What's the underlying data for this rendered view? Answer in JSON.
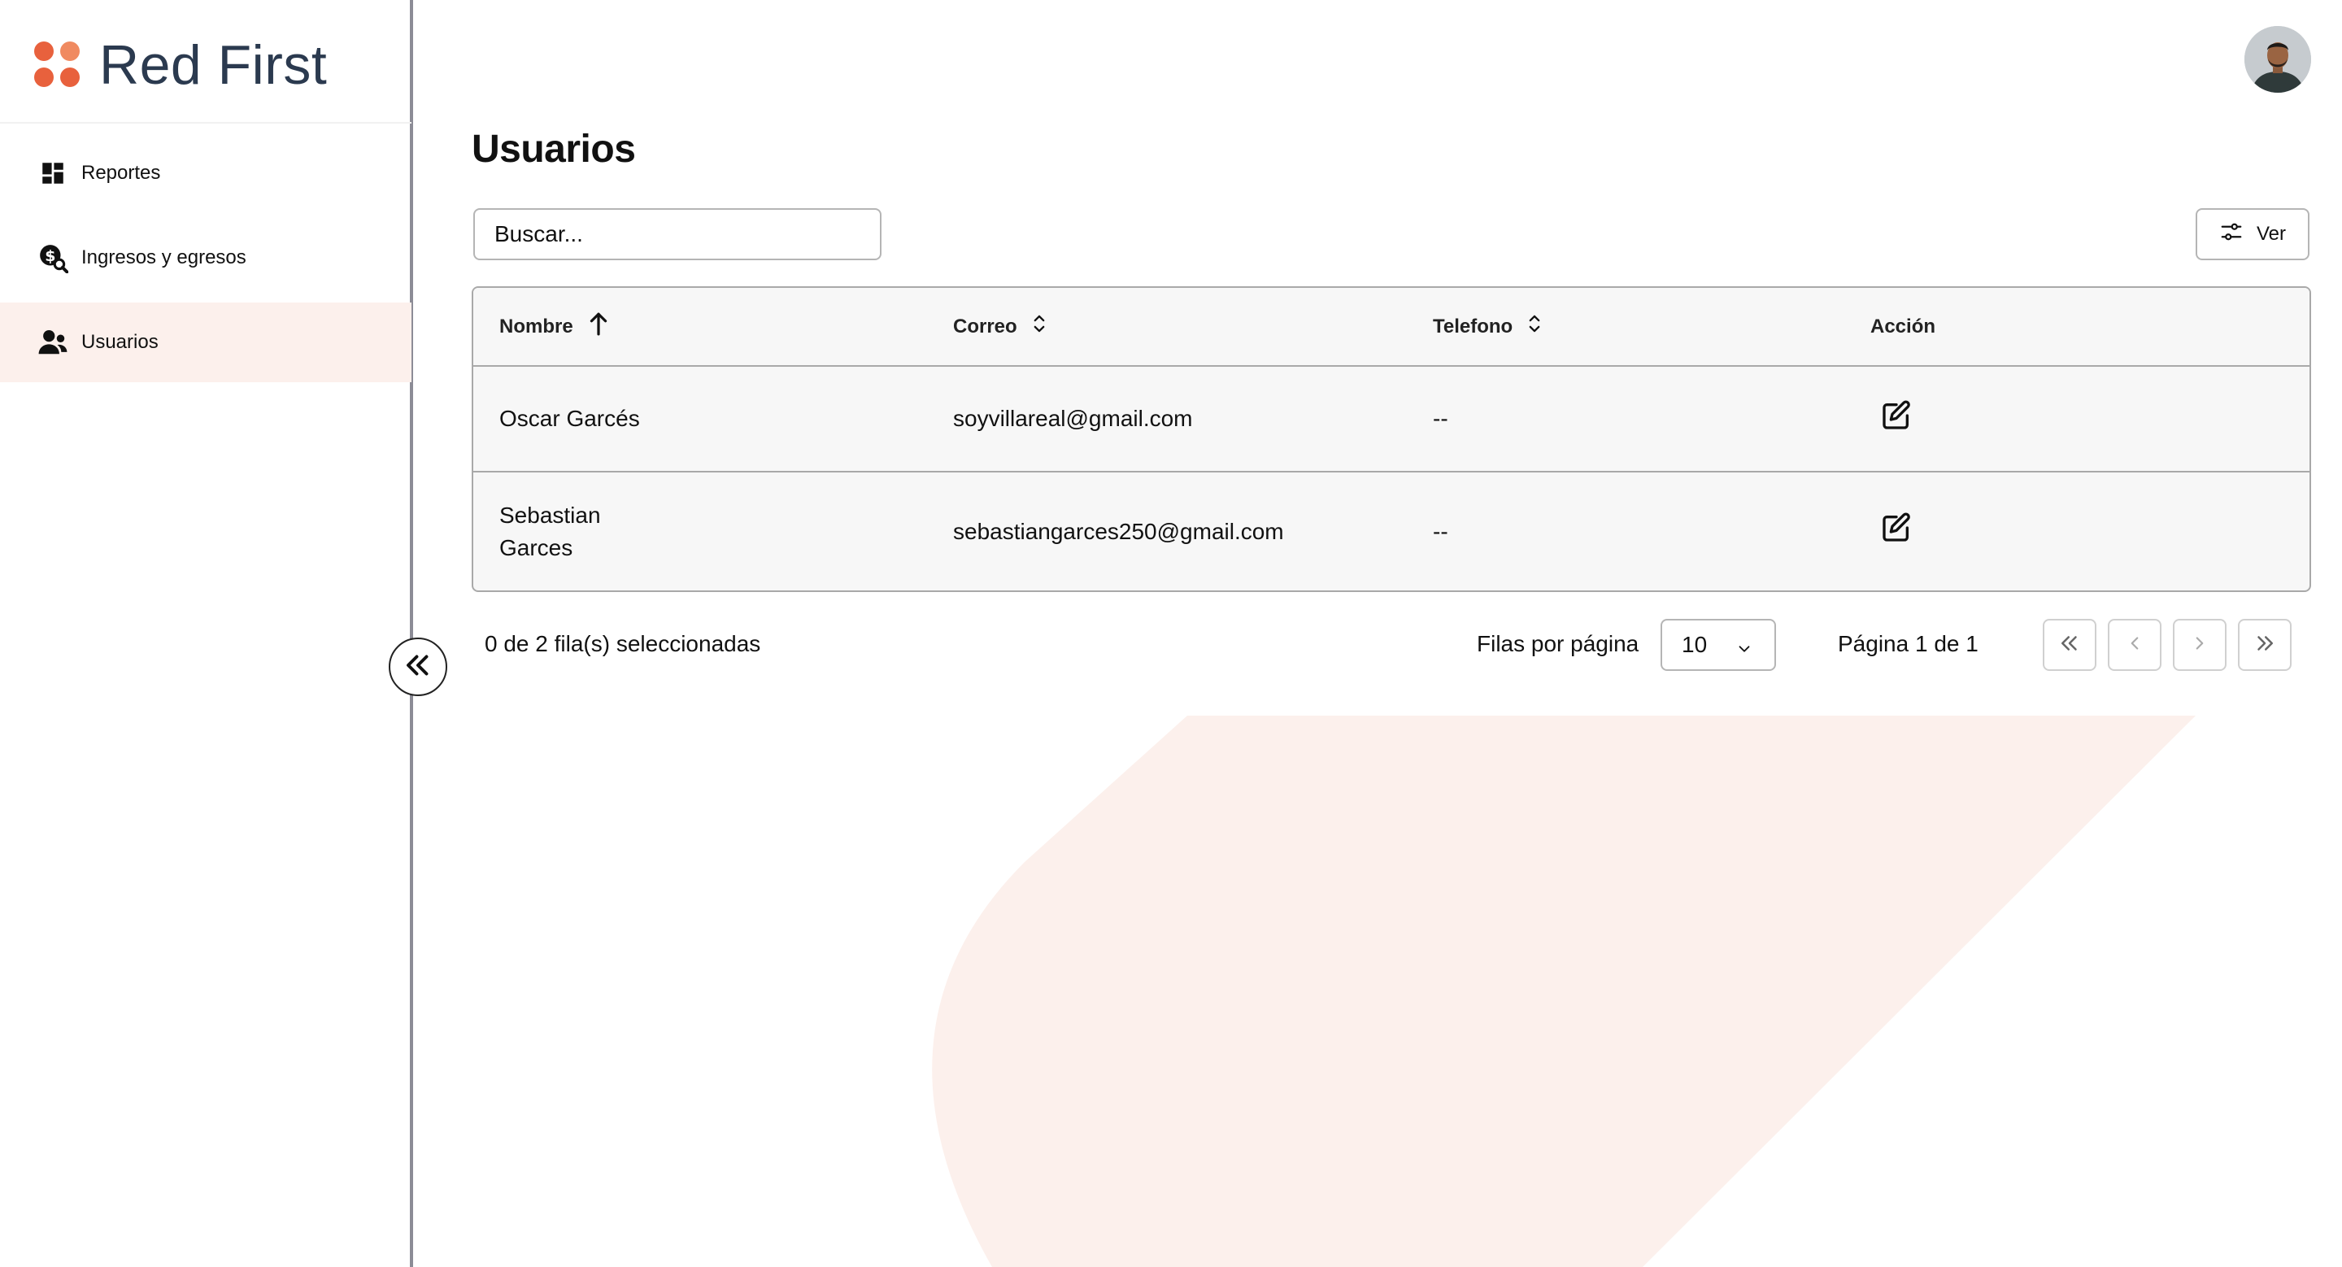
{
  "app": {
    "brand": "Red First",
    "brand_colors": [
      "#e8613d",
      "#f08a60",
      "#e8613d",
      "#e8613d"
    ]
  },
  "sidebar": {
    "items": [
      {
        "label": "Reportes",
        "icon": "dashboard-icon",
        "active": false
      },
      {
        "label": "Ingresos y egresos",
        "icon": "money-search-icon",
        "active": false
      },
      {
        "label": "Usuarios",
        "icon": "users-icon",
        "active": true
      }
    ],
    "collapse_icon": "double-chevron-left-icon"
  },
  "header": {
    "avatar_icon": "user-avatar"
  },
  "page": {
    "title": "Usuarios",
    "search": {
      "placeholder": "Buscar...",
      "value": ""
    },
    "view_button": {
      "label": "Ver",
      "icon": "sliders-icon"
    }
  },
  "table": {
    "columns": [
      {
        "label": "Nombre",
        "sort": "asc"
      },
      {
        "label": "Correo",
        "sort": "none"
      },
      {
        "label": "Telefono",
        "sort": "none"
      },
      {
        "label": "Acción"
      }
    ],
    "rows": [
      {
        "name": "Oscar Garcés",
        "email": "soyvillareal@gmail.com",
        "phone": "--",
        "action_icon": "edit-icon"
      },
      {
        "name": "Sebastian Garces",
        "email": "sebastiangarces250@gmail.com",
        "phone": "--",
        "action_icon": "edit-icon"
      }
    ]
  },
  "footer": {
    "selected_text": "0 de 2 fila(s) seleccionadas",
    "rows_per_page_label": "Filas por página",
    "rows_per_page_value": "10",
    "page_text": "Página 1 de 1",
    "buttons": [
      "first-page-icon",
      "prev-page-icon",
      "next-page-icon",
      "last-page-icon"
    ]
  },
  "colors": {
    "accent": "#e8613d",
    "active_bg": "#fcf0ec",
    "bg_shape": "#fcf0ec",
    "border": "#a9a9a9"
  }
}
